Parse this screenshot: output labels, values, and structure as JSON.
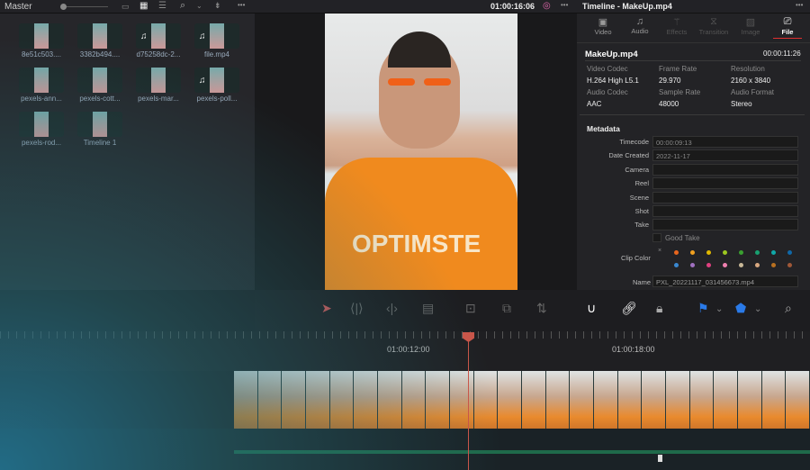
{
  "media_pool": {
    "title": "Master",
    "clips": [
      {
        "name": "8e51c503....",
        "audio": false
      },
      {
        "name": "3382b494....",
        "audio": false
      },
      {
        "name": "d75258dc-2...",
        "audio": true
      },
      {
        "name": "file.mp4",
        "audio": true
      },
      {
        "name": "pexels-ann...",
        "audio": false
      },
      {
        "name": "pexels-cott...",
        "audio": false
      },
      {
        "name": "pexels-mar...",
        "audio": false
      },
      {
        "name": "pexels-poll...",
        "audio": true
      },
      {
        "name": "pexels-rod...",
        "audio": false
      },
      {
        "name": "Timeline 1",
        "audio": false
      }
    ]
  },
  "viewer": {
    "timecode": "01:00:16:06"
  },
  "inspector": {
    "title": "Timeline - MakeUp.mp4",
    "tabs": [
      {
        "label": "Video"
      },
      {
        "label": "Audio"
      },
      {
        "label": "Effects"
      },
      {
        "label": "Transition"
      },
      {
        "label": "Image"
      },
      {
        "label": "File"
      }
    ],
    "active_tab": "File",
    "accent": "#e03030",
    "file_name": "MakeUp.mp4",
    "duration": "00:00:11:26",
    "props": [
      {
        "label": "Video Codec",
        "value": "H.264 High L5.1"
      },
      {
        "label": "Frame Rate",
        "value": "29.970"
      },
      {
        "label": "Resolution",
        "value": "2160 x 3840"
      },
      {
        "label": "Audio Codec",
        "value": "AAC"
      },
      {
        "label": "Sample Rate",
        "value": "48000"
      },
      {
        "label": "Audio Format",
        "value": "Stereo"
      }
    ],
    "metadata_title": "Metadata",
    "fields": [
      {
        "label": "Timecode",
        "value": "00:00:09:13"
      },
      {
        "label": "Date Created",
        "value": "2022-11-17"
      },
      {
        "label": "Camera",
        "value": ""
      },
      {
        "label": "Reel",
        "value": ""
      },
      {
        "label": "Scene",
        "value": ""
      },
      {
        "label": "Shot",
        "value": ""
      },
      {
        "label": "Take",
        "value": ""
      }
    ],
    "good_take": "Good Take",
    "clip_color_label": "Clip Color",
    "clip_colors": [
      "#e8661e",
      "#f0a020",
      "#e0b800",
      "#9cc820",
      "#3aa030",
      "#18a070",
      "#10a8a8",
      "#1068a8",
      "#3a88d0",
      "#a070c0",
      "#e04080",
      "#f080b0",
      "#c8b898",
      "#d8a880",
      "#b87020",
      "#a05838"
    ],
    "name_label": "Name",
    "name_value": "PXL_20221117_031456673.mp4"
  },
  "timeline": {
    "ticks": [
      "01:00:12:00",
      "01:00:18:00"
    ],
    "playhead_color": "#c8564a"
  }
}
